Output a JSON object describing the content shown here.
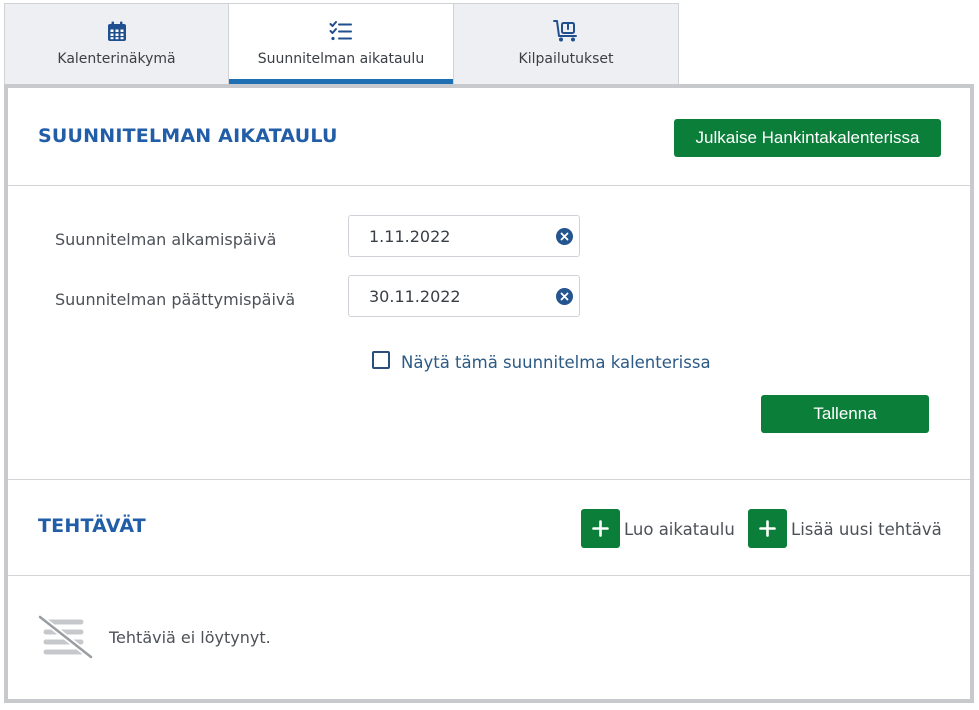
{
  "tabs": [
    {
      "label": "Kalenterinäkymä",
      "icon": "calendar-icon",
      "active": false
    },
    {
      "label": "Suunnitelman aikataulu",
      "icon": "checklist-icon",
      "active": true
    },
    {
      "label": "Kilpailutukset",
      "icon": "cart-icon",
      "active": false
    }
  ],
  "schedule": {
    "title": "SUUNNITELMAN AIKATAULU",
    "publish_label": "Julkaise Hankintakalenterissa",
    "start_label": "Suunnitelman alkamispäivä",
    "start_value": "1.11.2022",
    "end_label": "Suunnitelman päättymispäivä",
    "end_value": "30.11.2022",
    "show_in_calendar_label": "Näytä tämä suunnitelma kalenterissa",
    "show_in_calendar_checked": false,
    "save_label": "Tallenna"
  },
  "tasks": {
    "title": "TEHTÄVÄT",
    "create_schedule_label": "Luo aikataulu",
    "add_task_label": "Lisää uusi tehtävä",
    "empty_text": "Tehtäviä ei löytynyt."
  },
  "colors": {
    "accent_blue": "#225ea8",
    "button_green": "#0b7f3a",
    "tab_active_bar": "#1f6fb3"
  }
}
